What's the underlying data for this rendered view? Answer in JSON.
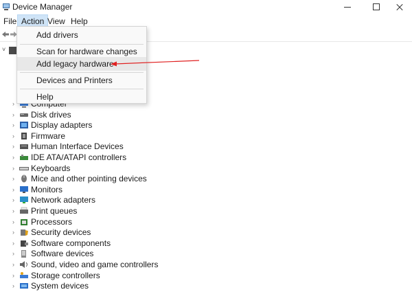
{
  "window": {
    "title": "Device Manager"
  },
  "menubar": {
    "items": [
      "File",
      "Action",
      "View",
      "Help"
    ]
  },
  "dropdown": {
    "items": [
      "Add drivers",
      "Scan for hardware changes",
      "Add legacy hardware",
      "Devices and Printers",
      "Help"
    ],
    "highlighted": "Add legacy hardware"
  },
  "tree": {
    "items": [
      {
        "label": "Computer",
        "icon": "computer-icon"
      },
      {
        "label": "Disk drives",
        "icon": "disk-drive-icon"
      },
      {
        "label": "Display adapters",
        "icon": "display-adapter-icon"
      },
      {
        "label": "Firmware",
        "icon": "firmware-icon"
      },
      {
        "label": "Human Interface Devices",
        "icon": "hid-icon"
      },
      {
        "label": "IDE ATA/ATAPI controllers",
        "icon": "ide-controller-icon"
      },
      {
        "label": "Keyboards",
        "icon": "keyboard-icon"
      },
      {
        "label": "Mice and other pointing devices",
        "icon": "mouse-icon"
      },
      {
        "label": "Monitors",
        "icon": "monitor-icon"
      },
      {
        "label": "Network adapters",
        "icon": "network-adapter-icon"
      },
      {
        "label": "Print queues",
        "icon": "printer-icon"
      },
      {
        "label": "Processors",
        "icon": "processor-icon"
      },
      {
        "label": "Security devices",
        "icon": "security-device-icon"
      },
      {
        "label": "Software components",
        "icon": "software-component-icon"
      },
      {
        "label": "Software devices",
        "icon": "software-device-icon"
      },
      {
        "label": "Sound, video and game controllers",
        "icon": "speaker-icon"
      },
      {
        "label": "Storage controllers",
        "icon": "storage-controller-icon"
      },
      {
        "label": "System devices",
        "icon": "system-device-icon"
      }
    ]
  },
  "colors": {
    "menu_active": "#cfe4f7",
    "arrow": "#e02020",
    "accent": "#2b7cd3"
  }
}
